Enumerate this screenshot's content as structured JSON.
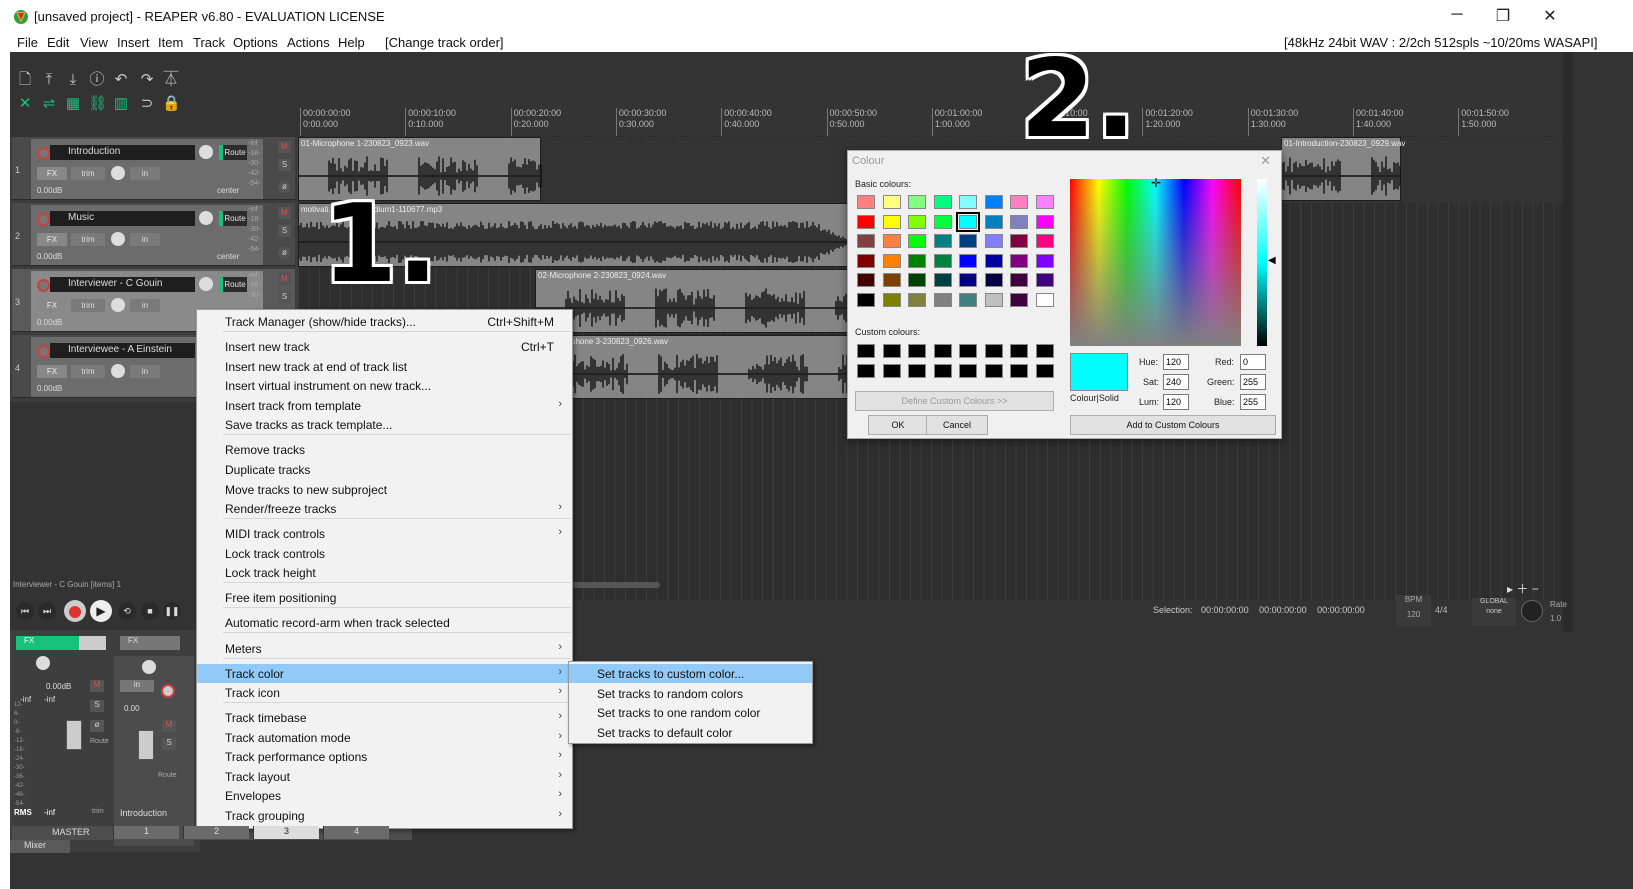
{
  "titlebar": {
    "title": "[unsaved project] - REAPER v6.80 - EVALUATION LICENSE",
    "minimize": "─",
    "restore": "❐",
    "close": "✕"
  },
  "menubar": {
    "items": [
      "File",
      "Edit",
      "View",
      "Insert",
      "Item",
      "Track",
      "Options",
      "Actions",
      "Help",
      "[Change track order]"
    ],
    "status": "[48kHz 24bit WAV : 2/2ch 512spls ~10/20ms WASAPI]"
  },
  "ruler": {
    "ticks": [
      {
        "a": "00:00:00:00",
        "b": "0:00.000"
      },
      {
        "a": "00:00:10:00",
        "b": "0:10.000"
      },
      {
        "a": "00:00:20:00",
        "b": "0:20.000"
      },
      {
        "a": "00:00:30:00",
        "b": "0:30.000"
      },
      {
        "a": "00:00:40:00",
        "b": "0:40.000"
      },
      {
        "a": "00:00:50:00",
        "b": "0:50.000"
      },
      {
        "a": "00:01:00:00",
        "b": "1:00.000"
      },
      {
        "a": "00:01:10:00",
        "b": "1:10.000"
      },
      {
        "a": "00:01:20:00",
        "b": "1:20.000"
      },
      {
        "a": "00:01:30:00",
        "b": "1:30.000"
      },
      {
        "a": "00:01:40:00",
        "b": "1:40.000"
      },
      {
        "a": "00:01:50:00",
        "b": "1:50.000"
      }
    ]
  },
  "tracks": [
    {
      "num": "1",
      "name": "Introduction",
      "route": "Route",
      "fx": "FX",
      "trim": "trim",
      "in": "in",
      "db": "0.00dB",
      "pan": "center",
      "meter": [
        "-inf",
        "-18-",
        "-30-",
        "-42-",
        "-54-"
      ]
    },
    {
      "num": "2",
      "name": "Music",
      "route": "Route",
      "fx": "FX",
      "trim": "trim",
      "in": "in",
      "db": "0.00dB",
      "pan": "center",
      "meter": [
        "-inf",
        "-18-",
        "-30-",
        "-42-",
        "-54-"
      ]
    },
    {
      "num": "3",
      "name": "Interviewer - C Gouin",
      "route": "Route",
      "fx": "FX",
      "trim": "trim",
      "in": "in",
      "db": "0.00dB",
      "pan": "",
      "meter": [
        "-inf",
        "-18-",
        "-30-"
      ]
    },
    {
      "num": "4",
      "name": "Interviewee - A Einstein",
      "route": "Route",
      "fx": "FX",
      "trim": "trim",
      "in": "in",
      "db": "0.00dB",
      "pan": "",
      "meter": []
    }
  ],
  "items": {
    "t1a": "01-Microphone 1-230823_0923.wav",
    "t1b": "01-Introduction-230823_0929.wav",
    "t2": "motivati... porate-medium1-110677.mp3",
    "t3": "02-Microphone 2-230823_0924.wav",
    "t4": "phone 3-230823_0926.wav"
  },
  "item_info": "Interviewer - C Gouin [items] 1",
  "selection": {
    "label": "Selection:",
    "start": "00:00:00:00",
    "end": "00:00:00:00",
    "len": "00:00:00:00",
    "bpm_label": "BPM",
    "bpm": "120",
    "sig": "4/4",
    "global": "GLOBAL",
    "none": "none",
    "rate": "Rate",
    "rate_val": "1.0"
  },
  "mixer": {
    "master_db": "0.00dB",
    "inf1": "-inf",
    "inf2": "-inf",
    "rms": "RMS",
    "rms_val": "-inf",
    "intro_label": "Introduction",
    "master_label": "MASTER",
    "tab": "Mixer",
    "fx": "FX",
    "in": "in",
    "db2": "0.00",
    "trim": "trim",
    "route": "Route",
    "scale": [
      "12-",
      "6-",
      "0-",
      "-6-",
      "-12-",
      "-18-",
      "-24-",
      "-30-",
      "-36-",
      "-42-",
      "-48-",
      "-54-"
    ],
    "nums": [
      "1",
      "2",
      "3",
      "4"
    ]
  },
  "context_menu": {
    "items": [
      {
        "label": "Track Manager (show/hide tracks)...",
        "shortcut": "Ctrl+Shift+M"
      },
      {
        "label": "Insert new track",
        "shortcut": "Ctrl+T"
      },
      {
        "label": "Insert new track at end of track list"
      },
      {
        "label": "Insert virtual instrument on new track..."
      },
      {
        "label": "Insert track from template",
        "arrow": "›"
      },
      {
        "label": "Save tracks as track template..."
      },
      {
        "label": "Remove tracks"
      },
      {
        "label": "Duplicate tracks"
      },
      {
        "label": "Move tracks to new subproject"
      },
      {
        "label": "Render/freeze tracks",
        "arrow": "›"
      },
      {
        "label": "MIDI track controls",
        "arrow": "›"
      },
      {
        "label": "Lock track controls"
      },
      {
        "label": "Lock track height"
      },
      {
        "label": "Free item positioning"
      },
      {
        "label": "Automatic record-arm when track selected"
      },
      {
        "label": "Meters",
        "arrow": "›"
      },
      {
        "label": "Track color",
        "arrow": "›"
      },
      {
        "label": "Track icon",
        "arrow": "›"
      },
      {
        "label": "Track timebase",
        "arrow": "›"
      },
      {
        "label": "Track automation mode",
        "arrow": "›"
      },
      {
        "label": "Track performance options",
        "arrow": "›"
      },
      {
        "label": "Track layout",
        "arrow": "›"
      },
      {
        "label": "Envelopes",
        "arrow": "›"
      },
      {
        "label": "Track grouping",
        "arrow": "›"
      }
    ]
  },
  "submenu": {
    "items": [
      "Set tracks to custom color...",
      "Set tracks to random colors",
      "Set tracks to one random color",
      "Set tracks to default color"
    ]
  },
  "colour_dialog": {
    "title": "Colour",
    "basic_label": "Basic colours:",
    "custom_label": "Custom colours:",
    "define": "Define Custom Colours >>",
    "ok": "OK",
    "cancel": "Cancel",
    "add": "Add to Custom Colours",
    "solid": "Colour|Solid",
    "hue_label": "Hue:",
    "sat_label": "Sat:",
    "lum_label": "Lum:",
    "red_label": "Red:",
    "green_label": "Green:",
    "blue_label": "Blue:",
    "hue": "120",
    "sat": "240",
    "lum": "120",
    "red": "0",
    "green": "255",
    "blue": "255",
    "selected_color": "#00ffff",
    "basic_colors": [
      "#ff8080",
      "#ffff80",
      "#80ff80",
      "#00ff80",
      "#80ffff",
      "#0080ff",
      "#ff80c0",
      "#ff80ff",
      "#ff0000",
      "#ffff00",
      "#80ff00",
      "#00ff40",
      "#00ffff",
      "#0080c0",
      "#8080c0",
      "#ff00ff",
      "#804040",
      "#ff8040",
      "#00ff00",
      "#008080",
      "#004080",
      "#8080ff",
      "#800040",
      "#ff0080",
      "#800000",
      "#ff8000",
      "#008000",
      "#008040",
      "#0000ff",
      "#0000a0",
      "#800080",
      "#8000ff",
      "#400000",
      "#804000",
      "#004000",
      "#004040",
      "#000080",
      "#000040",
      "#400040",
      "#400080",
      "#000000",
      "#808000",
      "#808040",
      "#808080",
      "#408080",
      "#c0c0c0",
      "#400040",
      "#ffffff"
    ]
  },
  "annotations": {
    "one": "1.",
    "two": "2."
  }
}
